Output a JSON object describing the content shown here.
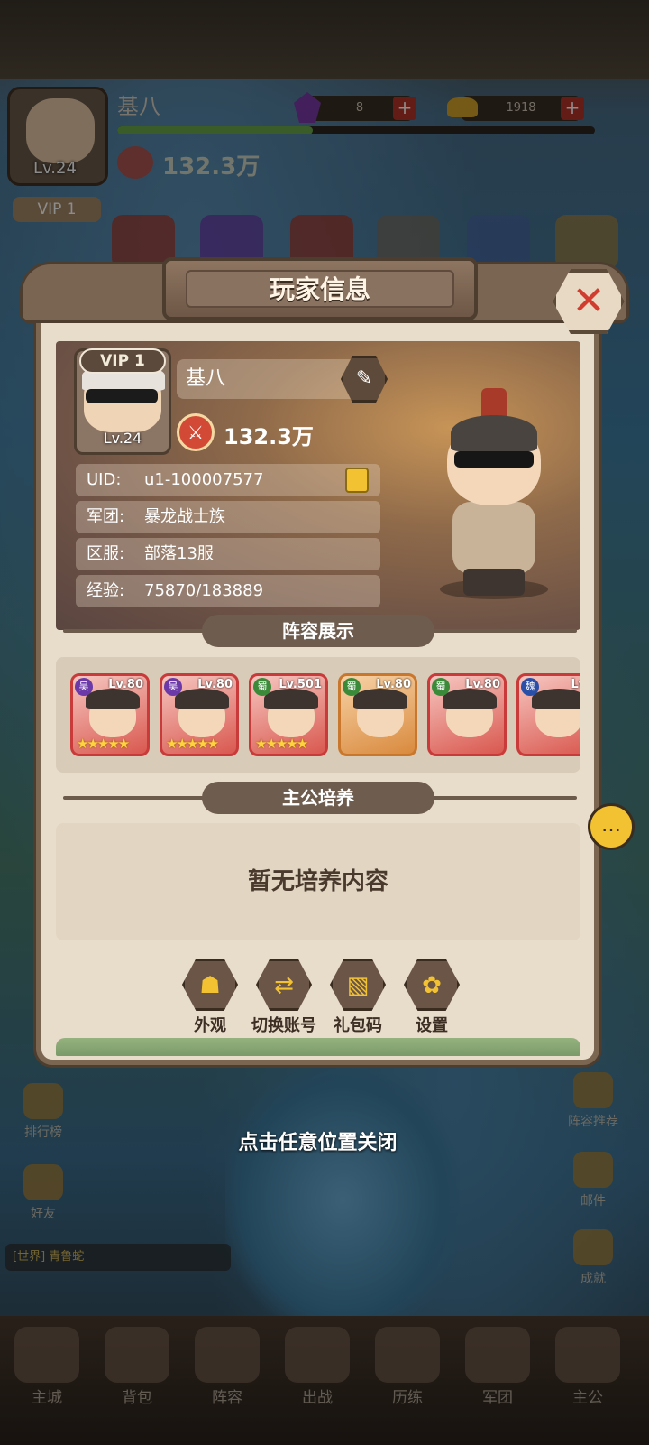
{
  "hud": {
    "player_name": "基八",
    "level": "Lv.24",
    "vip": "VIP 1",
    "power": "132.3万",
    "gem_count": "8",
    "gold_count": "1918",
    "exp_progress": 0.41
  },
  "dialog": {
    "title": "玩家信息",
    "close_label": "✕",
    "profile": {
      "vip": "VIP 1",
      "level": "Lv.24",
      "name": "基八",
      "power": "132.3万",
      "uid_label": "UID:",
      "uid_value": "u1-100007577",
      "guild_label": "军团:",
      "guild_value": "暴龙战士族",
      "server_label": "区服:",
      "server_value": "部落13服",
      "exp_label": "经验:",
      "exp_value": "75870/183889"
    },
    "lineup_title": "阵容展示",
    "lineup": [
      {
        "faction": "吴",
        "faction_color": "#6b3aa8",
        "level": "Lv.80",
        "stars": "★★★★★"
      },
      {
        "faction": "吴",
        "faction_color": "#6b3aa8",
        "level": "Lv.80",
        "stars": "★★★★★"
      },
      {
        "faction": "蜀",
        "faction_color": "#3a8a3a",
        "level": "Lv.501",
        "stars": "★★★★★"
      },
      {
        "faction": "蜀",
        "faction_color": "#3a8a3a",
        "level": "Lv.80",
        "stars": ""
      },
      {
        "faction": "蜀",
        "faction_color": "#3a8a3a",
        "level": "Lv.80",
        "stars": ""
      },
      {
        "faction": "魏",
        "faction_color": "#2a4fa8",
        "level": "Lv.",
        "stars": ""
      }
    ],
    "cultivate_title": "主公培养",
    "cultivate_empty": "暂无培养内容",
    "actions": [
      {
        "label": "外观",
        "icon": "mask-icon"
      },
      {
        "label": "切换账号",
        "icon": "switch-icon"
      },
      {
        "label": "礼包码",
        "icon": "gift-code-icon"
      },
      {
        "label": "设置",
        "icon": "gear-icon"
      }
    ]
  },
  "close_hint": "点击任意位置关闭",
  "side_left": [
    {
      "label": "排行榜"
    },
    {
      "label": "好友"
    }
  ],
  "side_right": [
    {
      "label": "阵容推荐"
    },
    {
      "label": "邮件"
    },
    {
      "label": "成就"
    }
  ],
  "chat_preview": "[世界] 青鲁蛇",
  "bottom_nav": [
    {
      "label": "主城"
    },
    {
      "label": "背包"
    },
    {
      "label": "阵容"
    },
    {
      "label": "出战"
    },
    {
      "label": "历练"
    },
    {
      "label": "军团"
    },
    {
      "label": "主公"
    }
  ]
}
